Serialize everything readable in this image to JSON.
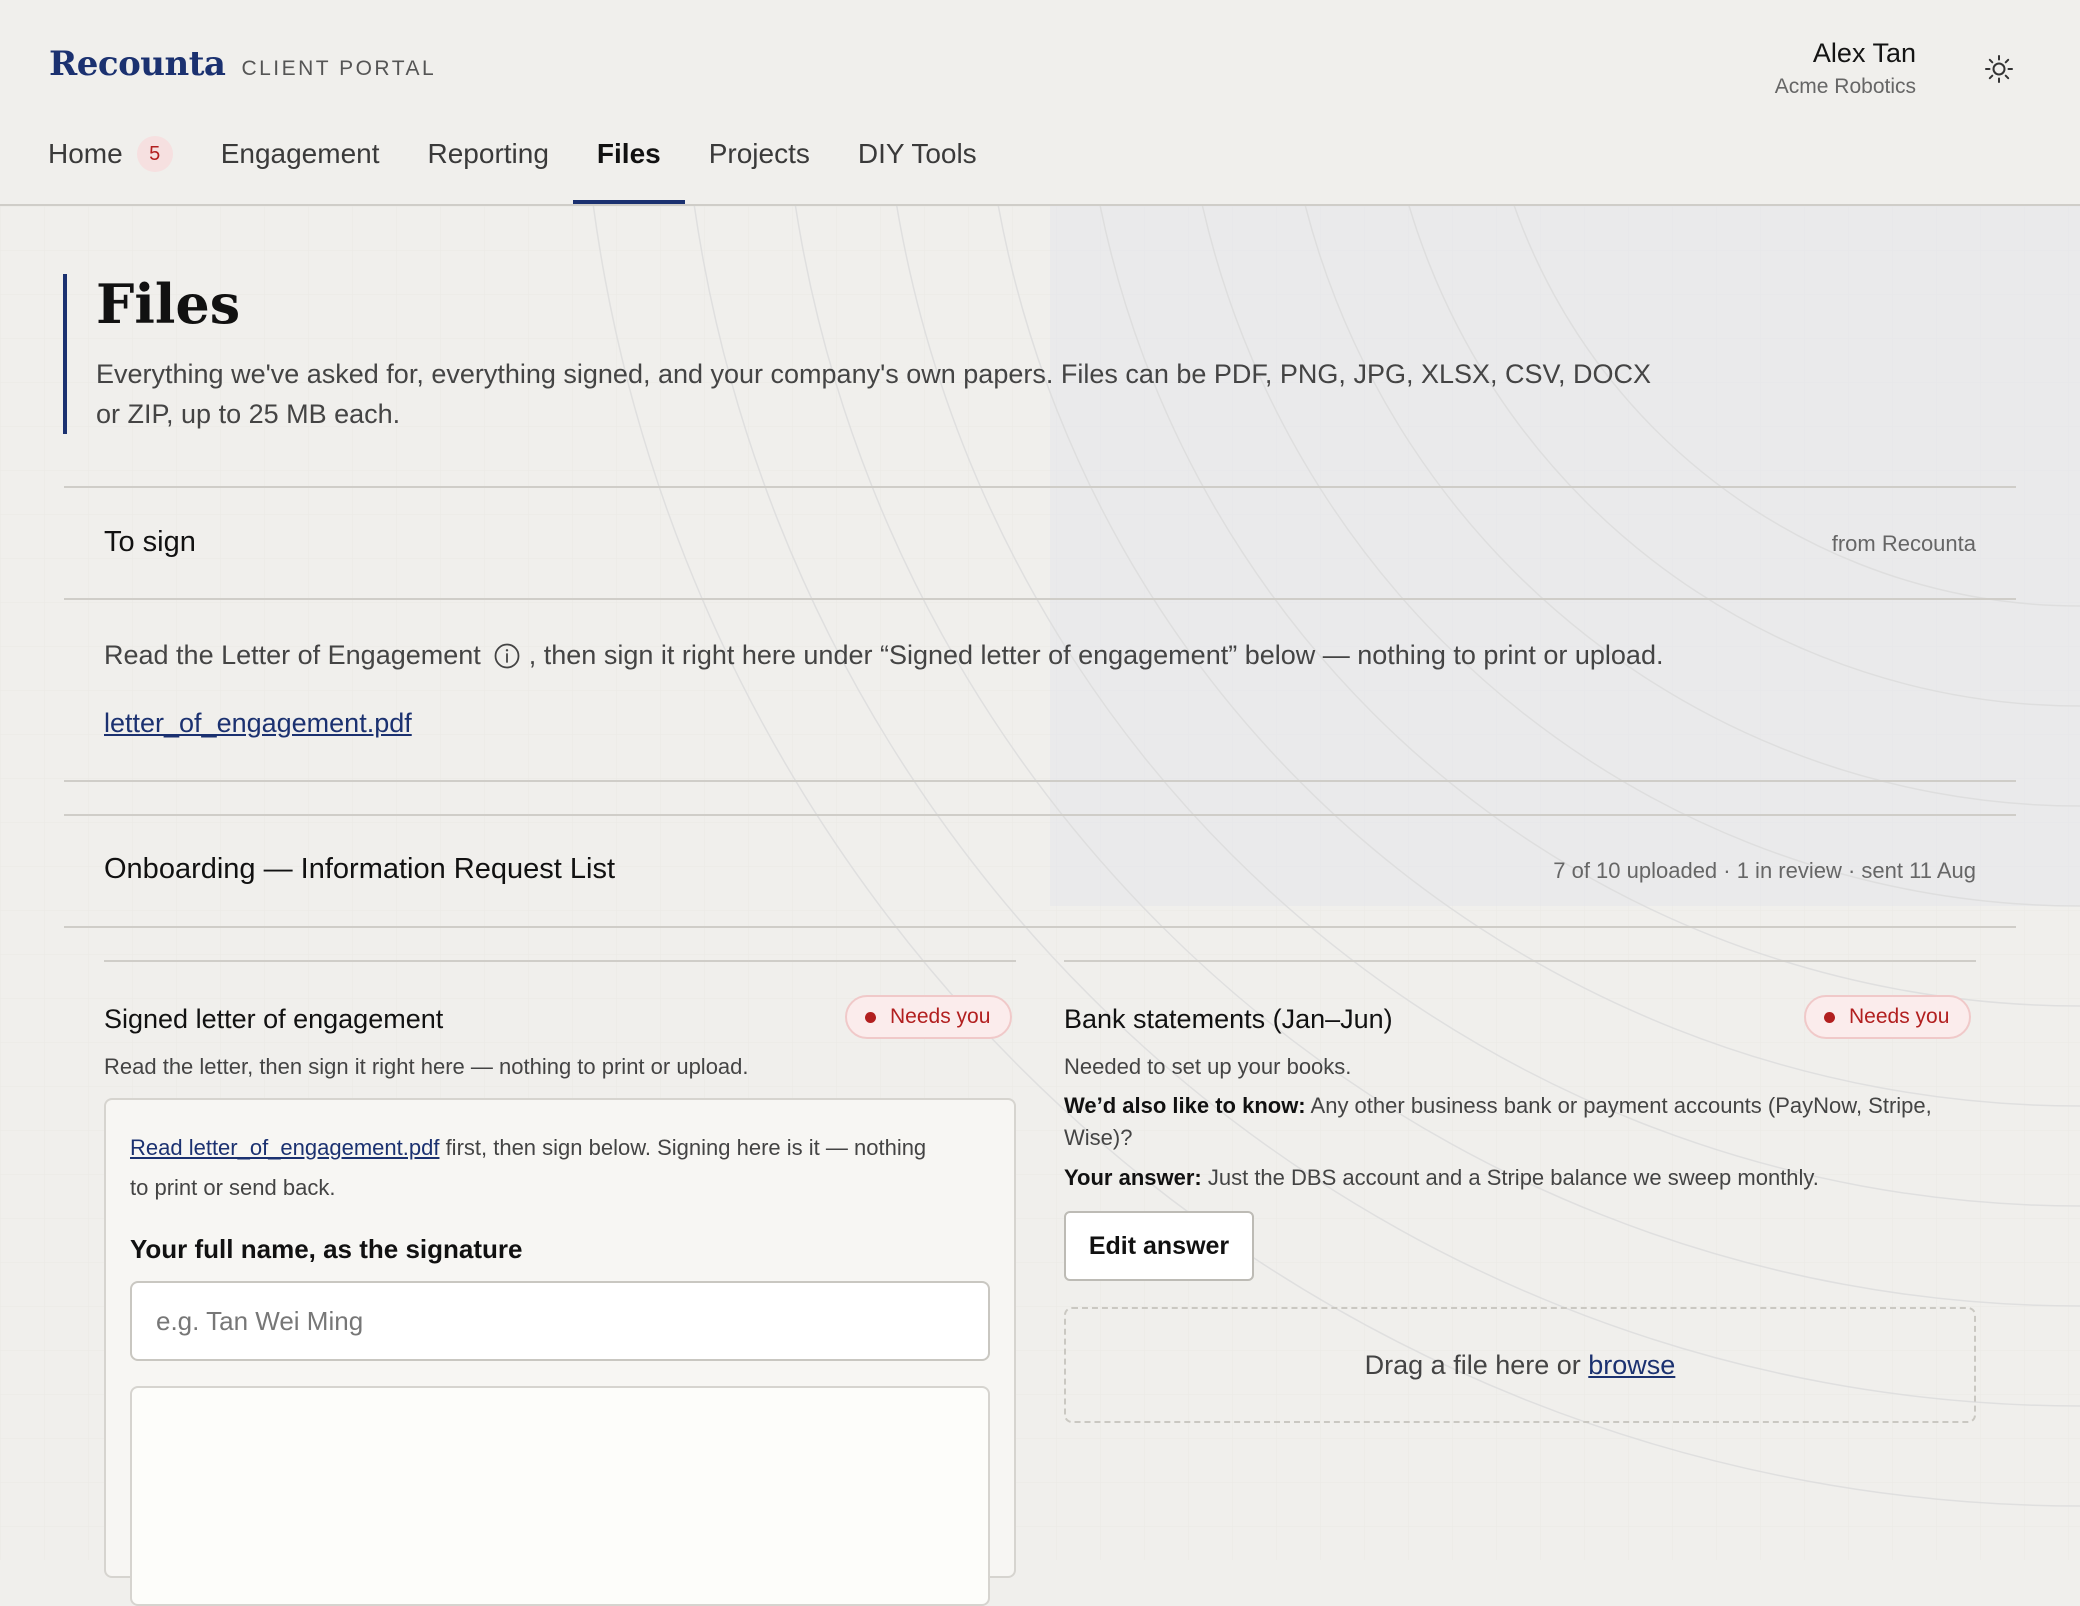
{
  "brand": {
    "name": "Recounta",
    "subtitle": "CLIENT PORTAL"
  },
  "user": {
    "name": "Alex Tan",
    "org": "Acme Robotics"
  },
  "nav": {
    "home": "Home",
    "home_badge": "5",
    "engagement": "Engagement",
    "reporting": "Reporting",
    "files": "Files",
    "projects": "Projects",
    "diy_tools": "DIY Tools"
  },
  "page": {
    "title": "Files",
    "description": "Everything we've asked for, everything signed, and your company's own papers. Files can be PDF, PNG, JPG, XLSX, CSV, DOCX or ZIP, up to 25 MB each."
  },
  "to_sign": {
    "title": "To sign",
    "meta": "from Recounta",
    "note_before": "Read the Letter of Engagement",
    "note_after": ", then sign it right here under “Signed letter of engagement” below — nothing to print or upload.",
    "file": "letter_of_engagement.pdf"
  },
  "onboarding": {
    "title": "Onboarding — Information Request List",
    "meta": "7 of 10 uploaded · 1 in review · sent 11 Aug"
  },
  "signed_letter": {
    "title": "Signed letter of engagement",
    "status": "Needs you",
    "description": "Read the letter, then sign it right here — nothing to print or upload.",
    "read_link": "Read letter_of_engagement.pdf",
    "intro_rest": " first, then sign below. Signing here is it — nothing to print or send back.",
    "name_label": "Your full name, as the signature",
    "name_placeholder": "e.g. Tan Wei Ming"
  },
  "bank_statements": {
    "title": "Bank statements (Jan–Jun)",
    "status": "Needs you",
    "description": "Needed to set up your books.",
    "question_label": "We’d also like to know:",
    "question": " Any other business bank or payment accounts (PayNow, Stripe, Wise)?",
    "answer_label": "Your answer:",
    "answer": " Just the DBS account and a Stripe balance we sweep monthly.",
    "edit_button": "Edit answer",
    "drop_text": "Drag a file here or ",
    "browse": "browse"
  },
  "colors": {
    "brand": "#1b3170",
    "alert": "#b21f1f",
    "background": "#f0efec"
  },
  "icons": {
    "theme": "sun-icon",
    "info": "info-icon"
  }
}
